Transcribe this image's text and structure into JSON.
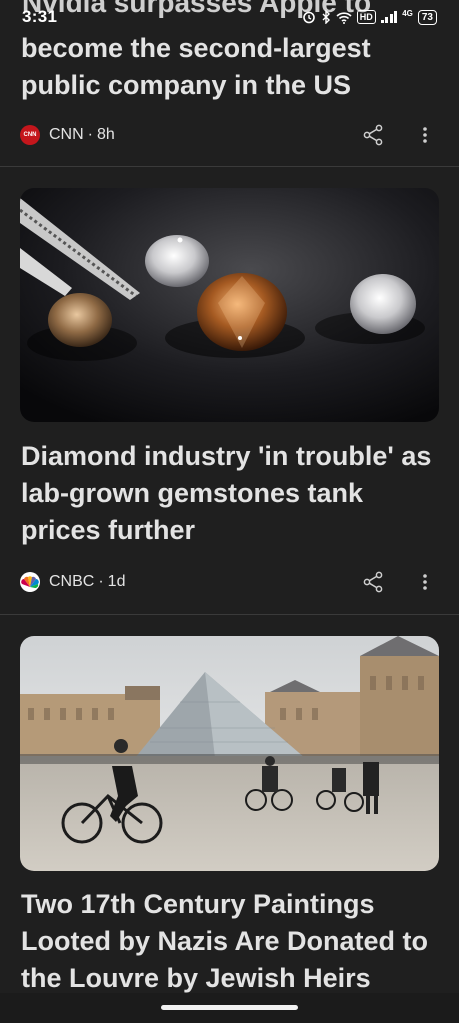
{
  "status_bar": {
    "time": "3:31",
    "network": "4G",
    "hd": "HD",
    "battery": "73"
  },
  "articles": [
    {
      "title_cut": "Nvidia surpasses Apple to",
      "title": "become the second-largest public company in the US",
      "source": "CNN",
      "time": "8h",
      "logo_text": "CNN"
    },
    {
      "title": "Diamond industry 'in trouble' as lab-grown gemstones tank prices further",
      "source": "CNBC",
      "time": "1d"
    },
    {
      "title": "Two 17th Century Paintings Looted by Nazis Are Donated to the Louvre by Jewish Heirs"
    }
  ],
  "separator": "·",
  "colors": {
    "background": "#1f1f1f",
    "text": "#e3e3e3",
    "cnn_red": "#c4161c"
  },
  "icons": [
    "alarm-icon",
    "bluetooth-icon",
    "wifi-icon",
    "signal-icon",
    "battery-icon",
    "share-icon",
    "more-vert-icon"
  ]
}
